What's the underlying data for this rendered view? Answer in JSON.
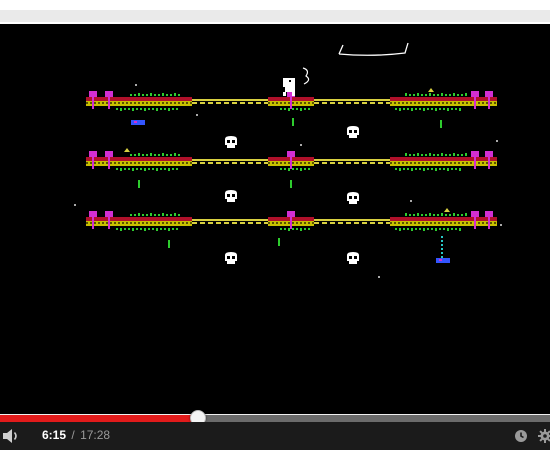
{
  "player": {
    "current_time": "6:15",
    "separator": "/",
    "duration": "17:28",
    "progress_fraction": 0.3578,
    "colors": {
      "progress": "#e21b1b",
      "track": "#6b6b6b",
      "controls_bg": "#1b1b1b"
    },
    "icons": [
      "volume-icon",
      "clock-icon",
      "gear-icon"
    ]
  },
  "game": {
    "background": "#000000",
    "colors": {
      "girder_red": "#b0102a",
      "girder_yellow": "#c8c000",
      "bridge_yellow": "#d8d040",
      "grass_green": "#2ecc2e",
      "post_magenta": "#d22fd2",
      "enemy_blue": "#3355ff",
      "chain_cyan": "#28c8c8",
      "skull_white": "#ffffff"
    },
    "rows": 3,
    "skulls": 6,
    "player_sprites": 1,
    "enemies": 2
  }
}
